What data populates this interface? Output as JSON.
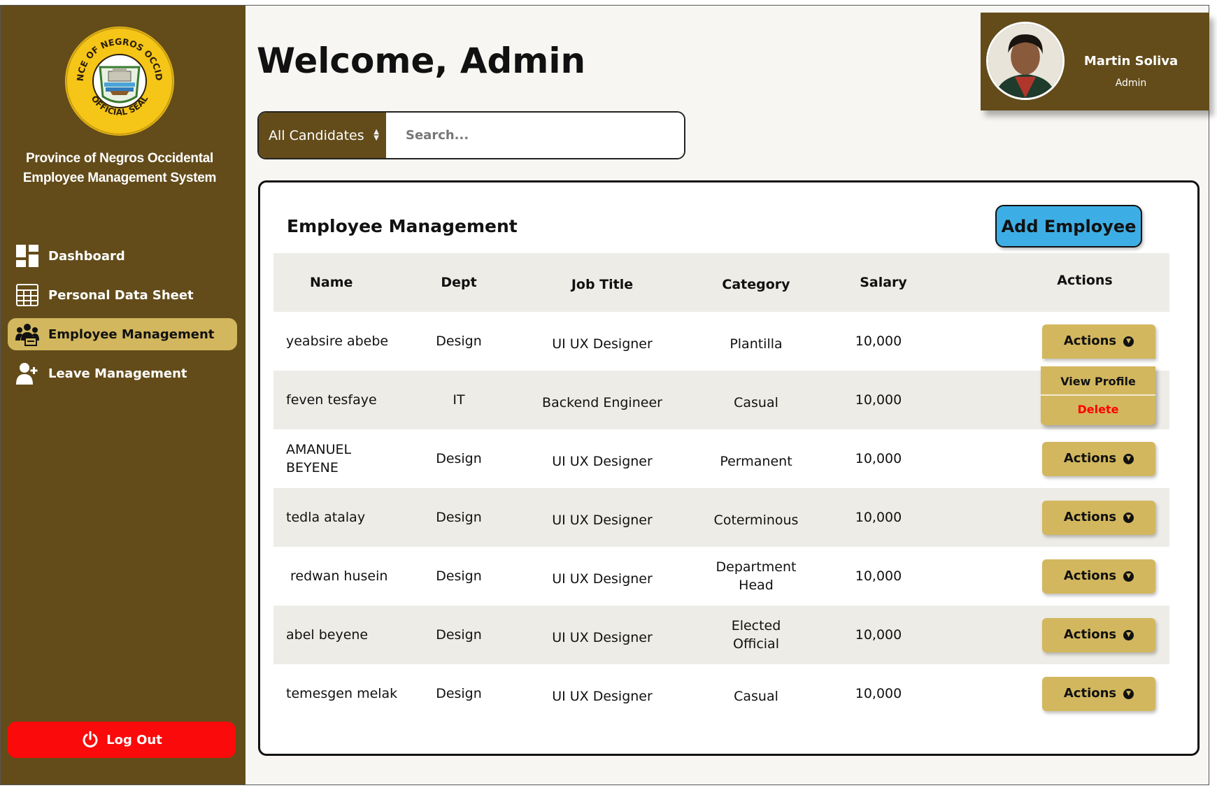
{
  "sidebar": {
    "org_line1": "Province of Negros Occidental",
    "org_line2": "Employee Management System",
    "seal_text_top": "PROVINCE OF NEGROS OCCIDENTAL",
    "seal_text_bottom": "OFFICIAL SEAL",
    "items": [
      {
        "label": "Dashboard",
        "icon": "dashboard-icon"
      },
      {
        "label": "Personal Data Sheet",
        "icon": "table-grid-icon"
      },
      {
        "label": "Employee Management",
        "icon": "team-icon",
        "active": true
      },
      {
        "label": "Leave Management",
        "icon": "user-add-icon"
      }
    ],
    "logout_label": "Log Out"
  },
  "header": {
    "welcome": "Welcome, Admin"
  },
  "search": {
    "filter_value": "All Candidates",
    "placeholder": "Search..."
  },
  "profile": {
    "name": "Martin Soliva",
    "role": "Admin"
  },
  "panel": {
    "title": "Employee Management",
    "add_button": "Add Employee"
  },
  "table": {
    "columns": [
      "Name",
      "Dept",
      "Job Title",
      "Category",
      "Salary",
      "Actions"
    ],
    "rows": [
      {
        "name": "yeabsire abebe",
        "dept": "Design",
        "job": "UI UX Designer",
        "category": "Plantilla",
        "salary": "10,000",
        "action": "Actions"
      },
      {
        "name": "feven tesfaye",
        "dept": "IT",
        "job": "Backend Engineer",
        "category": "Casual",
        "salary": "10,000",
        "action": "Actions"
      },
      {
        "name": "AMANUEL BEYENE",
        "dept": "Design",
        "job": "UI UX Designer",
        "category": "Permanent",
        "salary": "10,000",
        "action": "Actions"
      },
      {
        "name": "tedla atalay",
        "dept": "Design",
        "job": "UI UX Designer",
        "category": "Coterminous",
        "salary": "10,000",
        "action": "Actions"
      },
      {
        "name": "redwan husein",
        "dept": "Design",
        "job": "UI UX Designer",
        "category": "Department Head",
        "salary": "10,000",
        "action": "Actions"
      },
      {
        "name": "abel beyene",
        "dept": "Design",
        "job": "UI UX Designer",
        "category": "Elected Official",
        "salary": "10,000",
        "action": "Actions"
      },
      {
        "name": "temesgen melak",
        "dept": "Design",
        "job": "UI UX Designer",
        "category": "Casual",
        "salary": "10,000",
        "action": "Actions"
      }
    ]
  },
  "dropdown": {
    "view_profile": "View Profile",
    "delete": "Delete"
  },
  "colors": {
    "sidebar_bg": "#634c1a",
    "accent_gold": "#d2b75e",
    "add_button_blue": "#3daee5",
    "logout_red": "#fa0a0a",
    "delete_red": "#ff0000"
  }
}
